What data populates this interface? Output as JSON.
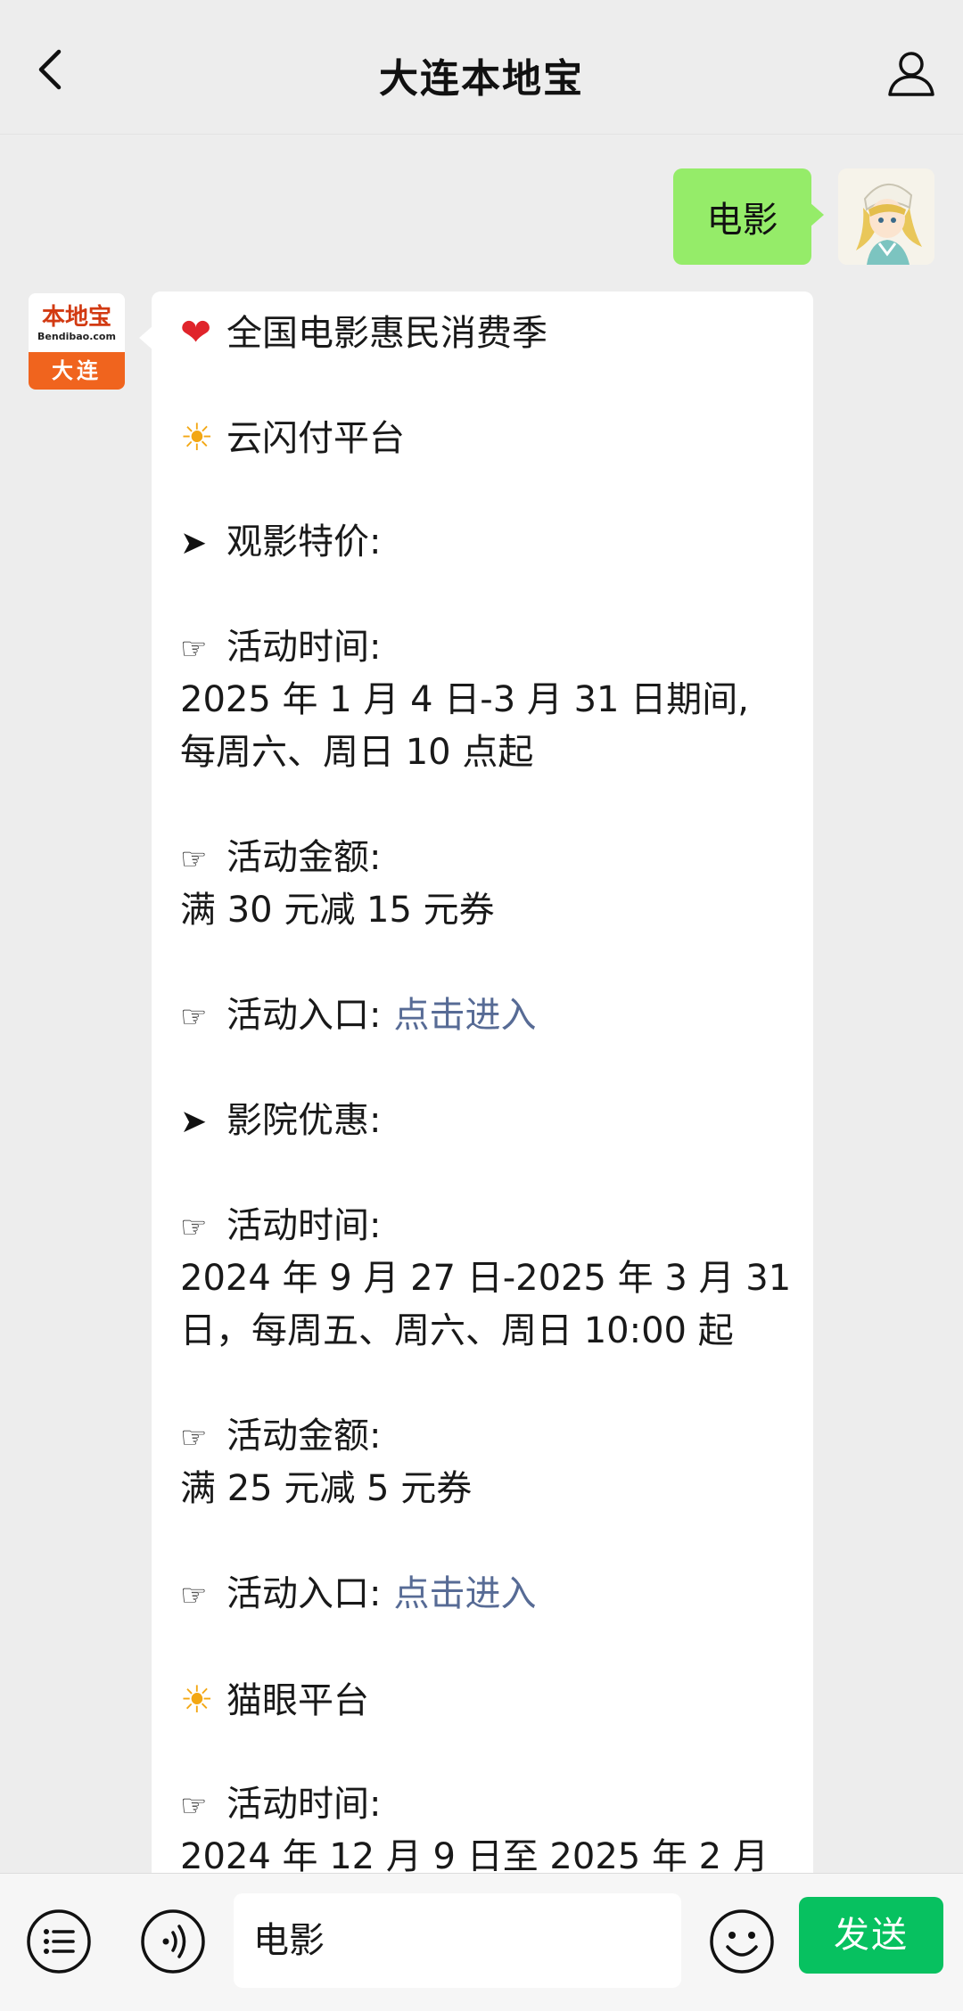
{
  "header": {
    "title": "大连本地宝"
  },
  "sent_message": {
    "text": "电影"
  },
  "recv_avatar": {
    "logo_text": "本地宝",
    "logo_domain": "Bendibao.com",
    "city": "大连"
  },
  "reply": {
    "title": "全国电影惠民消费季",
    "platform1": "云闪付平台",
    "section1": "观影特价:",
    "s1_time_label": "活动时间:",
    "s1_time_line1": "2025 年 1 月 4 日-3 月 31 日期间,",
    "s1_time_line2": "每周六、周日 10 点起",
    "s1_amount_label": "活动金额:",
    "s1_amount": "满 30 元减 15 元券",
    "s1_entry_label": "活动入口:",
    "s1_entry_link": "点击进入",
    "section2": "影院优惠:",
    "s2_time_label": "活动时间:",
    "s2_time_line1": "2024 年 9 月 27 日-2025 年 3 月 31",
    "s2_time_line2": "日，每周五、周六、周日 10:00 起",
    "s2_amount_label": "活动金额:",
    "s2_amount": "满 25 元减 5 元券",
    "s2_entry_label": "活动入口:",
    "s2_entry_link": "点击进入",
    "platform2": "猫眼平台",
    "s3_time_label": "活动时间:",
    "s3_time_line1": "2024 年 12 月 9 日至 2025 年 2 月"
  },
  "glyphs": {
    "heart": "❤",
    "sun": "☀",
    "arrow": "➤",
    "hand": "☞"
  },
  "input": {
    "value": "电影",
    "send_label": "发送"
  },
  "colors": {
    "background": "#ededed",
    "sent_bubble": "#95ec69",
    "link": "#576b95",
    "send_button": "#07c160",
    "heart": "#e0242b",
    "sun": "#f3a713"
  }
}
